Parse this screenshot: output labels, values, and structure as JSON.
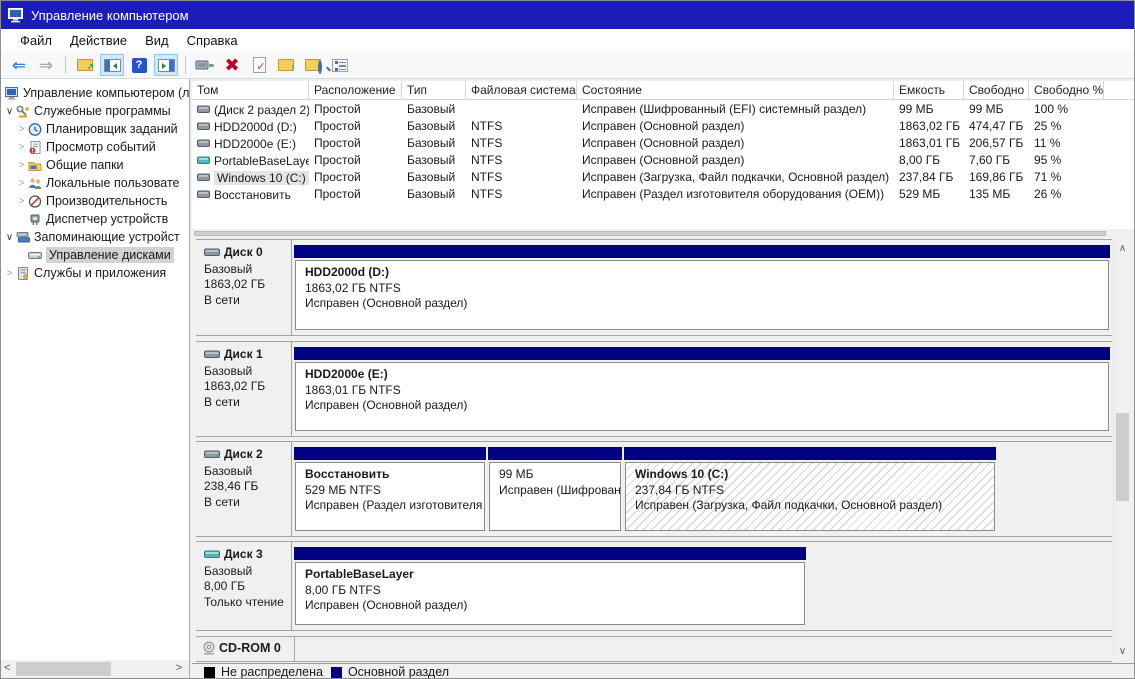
{
  "window": {
    "title": "Управление компьютером"
  },
  "menu": {
    "items": [
      "Файл",
      "Действие",
      "Вид",
      "Справка"
    ]
  },
  "toolbar": {
    "icons": [
      "back",
      "forward",
      "export-list",
      "show-console-tree",
      "help",
      "show-action-pane",
      "remote-connection",
      "delete",
      "validate",
      "folder-up",
      "explore",
      "properties"
    ],
    "help_glyph": "?"
  },
  "sidebar": {
    "items": [
      {
        "label": "Управление компьютером (л"
      },
      {
        "label": "Служебные программы"
      },
      {
        "label": "Планировщик заданий"
      },
      {
        "label": "Просмотр событий"
      },
      {
        "label": "Общие папки"
      },
      {
        "label": "Локальные пользовате"
      },
      {
        "label": "Производительность"
      },
      {
        "label": "Диспетчер устройств"
      },
      {
        "label": "Запоминающие устройст"
      },
      {
        "label": "Управление дисками"
      },
      {
        "label": "Службы и приложения"
      }
    ]
  },
  "volumes": {
    "headers": [
      "Том",
      "Расположение",
      "Тип",
      "Файловая система",
      "Состояние",
      "Емкость",
      "Свободно",
      "Свободно %"
    ],
    "rows": [
      {
        "name": "(Диск 2 раздел 2)",
        "layout": "Простой",
        "type": "Базовый",
        "fs": "",
        "status": "Исправен (Шифрованный (EFI) системный раздел)",
        "capacity": "99 МБ",
        "free": "99 МБ",
        "free_pct": "100 %"
      },
      {
        "name": "HDD2000d (D:)",
        "layout": "Простой",
        "type": "Базовый",
        "fs": "NTFS",
        "status": "Исправен (Основной раздел)",
        "capacity": "1863,02 ГБ",
        "free": "474,47 ГБ",
        "free_pct": "25 %"
      },
      {
        "name": "HDD2000e (E:)",
        "layout": "Простой",
        "type": "Базовый",
        "fs": "NTFS",
        "status": "Исправен (Основной раздел)",
        "capacity": "1863,01 ГБ",
        "free": "206,57 ГБ",
        "free_pct": "11 %"
      },
      {
        "name": "PortableBaseLayer",
        "layout": "Простой",
        "type": "Базовый",
        "fs": "NTFS",
        "status": "Исправен (Основной раздел)",
        "capacity": "8,00 ГБ",
        "free": "7,60 ГБ",
        "free_pct": "95 %"
      },
      {
        "name": "Windows 10 (C:)",
        "layout": "Простой",
        "type": "Базовый",
        "fs": "NTFS",
        "status": "Исправен (Загрузка, Файл подкачки, Основной раздел)",
        "capacity": "237,84 ГБ",
        "free": "169,86 ГБ",
        "free_pct": "71 %"
      },
      {
        "name": "Восстановить",
        "layout": "Простой",
        "type": "Базовый",
        "fs": "NTFS",
        "status": "Исправен (Раздел изготовителя оборудования (OEM))",
        "capacity": "529 МБ",
        "free": "135 МБ",
        "free_pct": "26 %"
      }
    ]
  },
  "disks": [
    {
      "name": "Диск 0",
      "type": "Базовый",
      "size": "1863,02 ГБ",
      "state": "В сети",
      "partitions": [
        {
          "name": "HDD2000d  (D:)",
          "detail": "1863,02 ГБ NTFS",
          "status": "Исправен (Основной раздел)"
        }
      ]
    },
    {
      "name": "Диск 1",
      "type": "Базовый",
      "size": "1863,02 ГБ",
      "state": "В сети",
      "partitions": [
        {
          "name": "HDD2000e  (E:)",
          "detail": "1863,01 ГБ NTFS",
          "status": "Исправен (Основной раздел)"
        }
      ]
    },
    {
      "name": "Диск 2",
      "type": "Базовый",
      "size": "238,46 ГБ",
      "state": "В сети",
      "partitions": [
        {
          "name": "Восстановить",
          "detail": "529 МБ NTFS",
          "status": "Исправен (Раздел изготовителя оборудования (OEM))"
        },
        {
          "name": "",
          "detail": "99 МБ",
          "status": "Исправен (Шифрованный (EFI) системный раздел)"
        },
        {
          "name": "Windows 10  (C:)",
          "detail": "237,84 ГБ NTFS",
          "status": "Исправен (Загрузка, Файл подкачки, Основной раздел)"
        }
      ]
    },
    {
      "name": "Диск 3",
      "type": "Базовый",
      "size": "8,00 ГБ",
      "state": "Только чтение",
      "partitions": [
        {
          "name": "PortableBaseLayer",
          "detail": "8,00 ГБ NTFS",
          "status": "Исправен (Основной раздел)"
        }
      ]
    }
  ],
  "cdrom": {
    "name": "CD-ROM 0"
  },
  "legend": [
    {
      "label": "Не распределена",
      "color": "#000000"
    },
    {
      "label": "Основной раздел",
      "color": "#000082"
    }
  ],
  "colors": {
    "titlebar": "#1b1db8",
    "partition_bar": "#000082"
  }
}
